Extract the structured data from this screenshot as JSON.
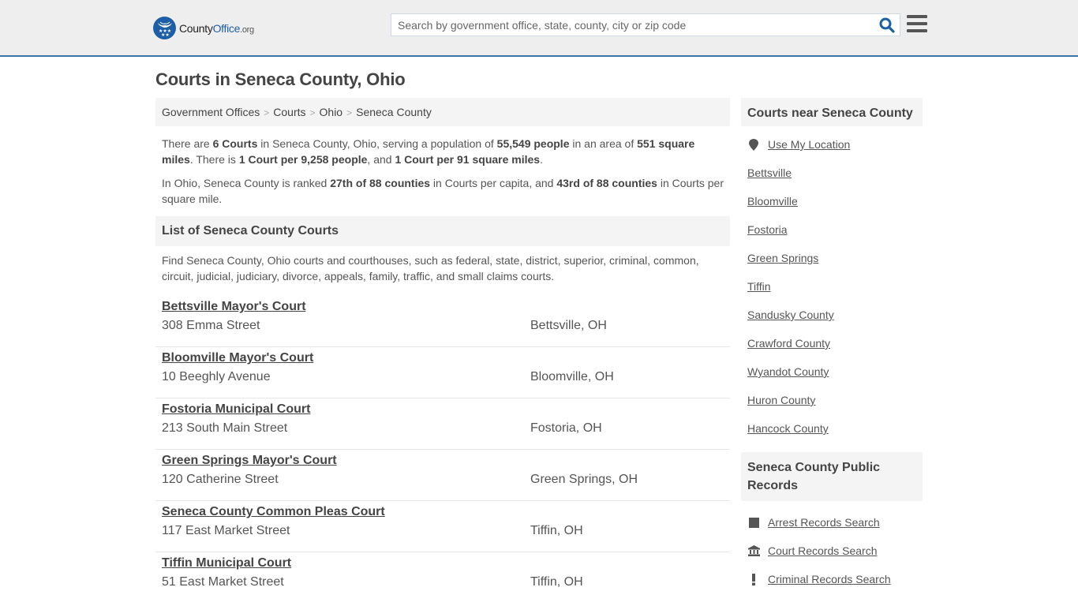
{
  "header": {
    "logo": {
      "county": "County",
      "office": "Office",
      "org": ".org"
    },
    "search": {
      "placeholder": "Search by government office, state, county, city or zip code",
      "value": ""
    },
    "icons": {
      "search": "search-icon",
      "menu": "hamburger-menu-icon",
      "logo": "eagle-stars-badge-icon"
    }
  },
  "page": {
    "title": "Courts in Seneca County, Ohio"
  },
  "breadcrumb": [
    {
      "label": "Government Offices"
    },
    {
      "label": "Courts"
    },
    {
      "label": "Ohio"
    },
    {
      "label": "Seneca County"
    }
  ],
  "summary": {
    "p1": {
      "t1": "There are ",
      "b1": "6 Courts",
      "t2": " in Seneca County, Ohio, serving a population of ",
      "b2": "55,549 people",
      "t3": " in an area of ",
      "b3": "551 square miles",
      "t4": ". There is ",
      "b4": "1 Court per 9,258 people",
      "t5": ", and ",
      "b5": "1 Court per 91 square miles",
      "t6": "."
    },
    "p2": {
      "t1": "In Ohio, Seneca County is ranked ",
      "b1": "27th of 88 counties",
      "t2": " in Courts per capita, and ",
      "b2": "43rd of 88 counties",
      "t3": " in Courts per square mile."
    }
  },
  "list": {
    "title": "List of Seneca County Courts",
    "description": "Find Seneca County, Ohio courts and courthouses, such as federal, state, district, superior, criminal, common, circuit, judicial, judiciary, divorce, appeals, family, traffic, and small claims courts.",
    "courts": [
      {
        "name": "Bettsville Mayor's Court",
        "address": "308 Emma Street",
        "city": "Bettsville, OH"
      },
      {
        "name": "Bloomville Mayor's Court",
        "address": "10 Beeghly Avenue",
        "city": "Bloomville, OH"
      },
      {
        "name": "Fostoria Municipal Court",
        "address": "213 South Main Street",
        "city": "Fostoria, OH"
      },
      {
        "name": "Green Springs Mayor's Court",
        "address": "120 Catherine Street",
        "city": "Green Springs, OH"
      },
      {
        "name": "Seneca County Common Pleas Court",
        "address": "117 East Market Street",
        "city": "Tiffin, OH"
      },
      {
        "name": "Tiffin Municipal Court",
        "address": "51 East Market Street",
        "city": "Tiffin, OH"
      }
    ]
  },
  "sidebar": {
    "nearby": {
      "title": "Courts near Seneca County",
      "use_location": "Use My Location",
      "links": [
        "Bettsville",
        "Bloomville",
        "Fostoria",
        "Green Springs",
        "Tiffin",
        "Sandusky County",
        "Crawford County",
        "Wyandot County",
        "Huron County",
        "Hancock County"
      ]
    },
    "records": {
      "title": "Seneca County Public Records",
      "links": [
        {
          "label": "Arrest Records Search",
          "icon": "square-icon"
        },
        {
          "label": "Court Records Search",
          "icon": "courthouse-icon"
        },
        {
          "label": "Criminal Records Search",
          "icon": "exclamation-icon"
        }
      ]
    }
  },
  "colors": {
    "brand_blue": "#1d5fa6",
    "header_border": "#3a77a8",
    "header_bg": "#eeeeee",
    "panel_bg": "#f4f4f4",
    "text": "#555555"
  }
}
